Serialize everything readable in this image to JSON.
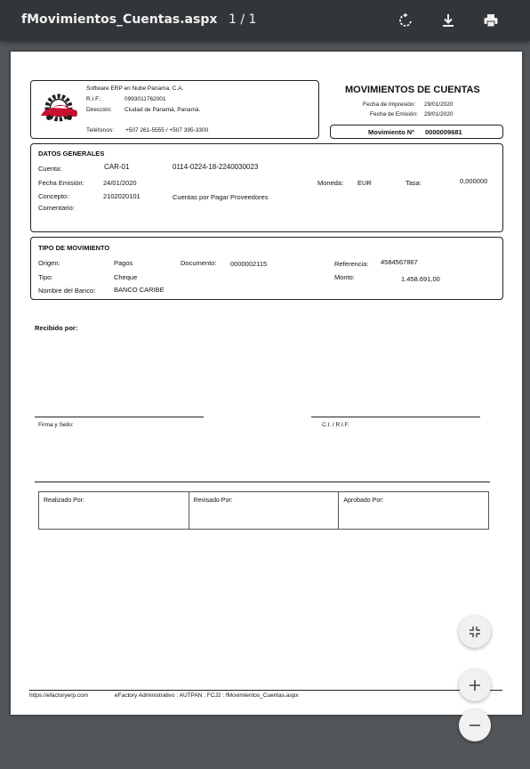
{
  "viewer": {
    "file_title": "fMovimientos_Cuentas.aspx",
    "page_indicator": "1 / 1"
  },
  "company": {
    "name": "Software ERP en Nube Panama, C.A.",
    "rif_label": "R.I.F.:",
    "rif_value": "0993011762001",
    "address_label": "Dirección:",
    "address_value": "Ciudad de Panamá, Panamá.",
    "phones_label": "Teléfonos:",
    "phones_value": "+507 261-5555 / +507 395-3300"
  },
  "header": {
    "title": "MOVIMIENTOS DE CUENTAS",
    "print_date_label": "Fecha de Impresión:",
    "print_date_value": "29/01/2020",
    "issue_date_label": "Fecha de Emisión:",
    "issue_date_value": "29/01/2020",
    "movement_label": "Movimiento Nº",
    "movement_value": "0000009681"
  },
  "general": {
    "section_title": "DATOS GENERALES",
    "account_label": "Cuenta:",
    "account_code": "CAR-01",
    "account_number": "0114-0224-18-2240030023",
    "issue_date_label": "Fecha Emisión:",
    "issue_date_value": "24/01/2020",
    "currency_label": "Moneda:",
    "currency_value": "EUR",
    "rate_label": "Tasa:",
    "rate_value": "0,000000",
    "concept_label": "Concepto:",
    "concept_code": "2102020101",
    "concept_desc": "Cuentas por Pagar Proveedores",
    "comment_label": "Comentario:"
  },
  "movement": {
    "section_title": "TIPO DE MOVIMIENTO",
    "origin_label": "Origen:",
    "origin_value": "Pagos",
    "document_label": "Documento:",
    "document_value": "0000002115",
    "reference_label": "Referencia:",
    "reference_value": "4584567867",
    "type_label": "Tipo:",
    "type_value": "Cheque",
    "amount_label": "Monto:",
    "amount_value": "1.458.691,00",
    "bank_label": "Nombre del Banco:",
    "bank_value": "BANCO CARIBE"
  },
  "signatures": {
    "received_label": "Recibido por:",
    "sign_label": "Firma y Sello:",
    "ci_label": "C.I. / R.I.F.",
    "made_by": "Realizado Por:",
    "reviewed_by": "Revisado Por:",
    "approved_by": "Aprobado Por:"
  },
  "footer": {
    "url": "https://efactoryerp.com",
    "info": "eFactory Administrativo  :  AUTPAN  :  FCJ2  :  fMovimientos_Cuentas.aspx"
  },
  "icons": {
    "logo_accent": "#c8102e",
    "toolbar_bg": "#323639",
    "viewer_bg": "#525659"
  }
}
